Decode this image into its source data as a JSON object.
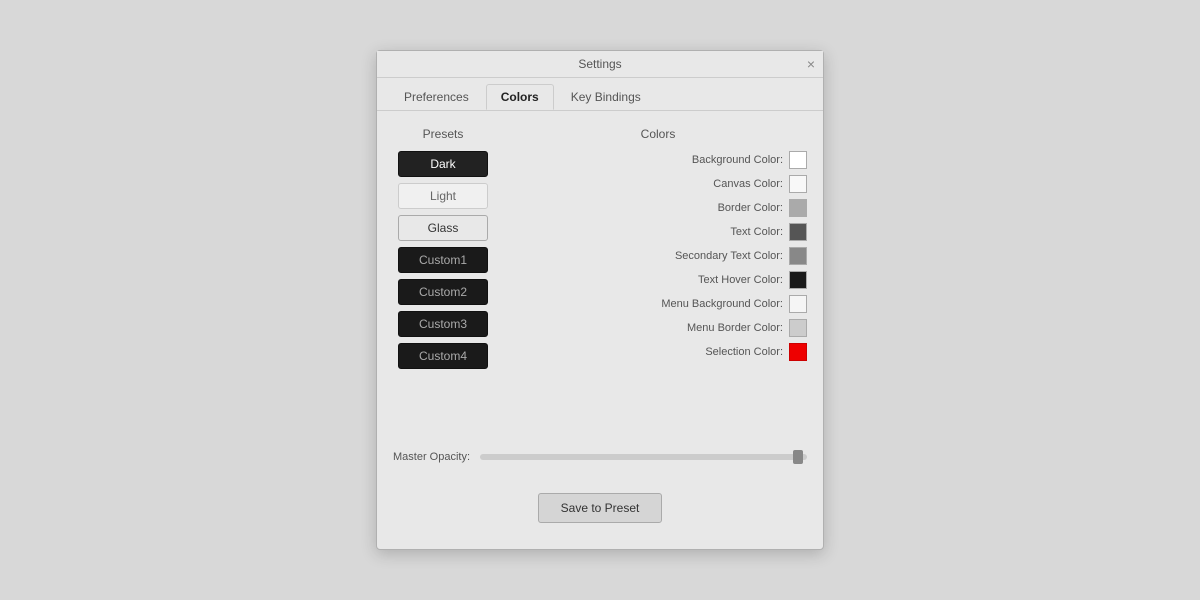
{
  "dialog": {
    "title": "Settings",
    "close_icon": "×"
  },
  "tabs": [
    {
      "id": "preferences",
      "label": "Preferences",
      "active": false
    },
    {
      "id": "colors",
      "label": "Colors",
      "active": true
    },
    {
      "id": "keybindings",
      "label": "Key Bindings",
      "active": false
    }
  ],
  "presets": {
    "title": "Presets",
    "items": [
      {
        "id": "dark",
        "label": "Dark",
        "style": "dark"
      },
      {
        "id": "light",
        "label": "Light",
        "style": "light"
      },
      {
        "id": "glass",
        "label": "Glass",
        "style": "glass"
      },
      {
        "id": "custom1",
        "label": "Custom1",
        "style": "custom1"
      },
      {
        "id": "custom2",
        "label": "Custom2",
        "style": "custom2"
      },
      {
        "id": "custom3",
        "label": "Custom3",
        "style": "custom3"
      },
      {
        "id": "custom4",
        "label": "Custom4",
        "style": "custom4"
      }
    ]
  },
  "colors": {
    "title": "Colors",
    "items": [
      {
        "id": "background-color",
        "label": "Background Color:",
        "swatch": "#ffffff"
      },
      {
        "id": "canvas-color",
        "label": "Canvas Color:",
        "swatch": "#f8f8f8"
      },
      {
        "id": "border-color",
        "label": "Border Color:",
        "swatch": "#aaaaaa"
      },
      {
        "id": "text-color",
        "label": "Text Color:",
        "swatch": "#555555"
      },
      {
        "id": "secondary-text-color",
        "label": "Secondary Text Color:",
        "swatch": "#888888"
      },
      {
        "id": "text-hover-color",
        "label": "Text Hover Color:",
        "swatch": "#1a1a1a"
      },
      {
        "id": "menu-background-color",
        "label": "Menu Background Color:",
        "swatch": "#f5f5f5"
      },
      {
        "id": "menu-border-color",
        "label": "Menu Border Color:",
        "swatch": "#cccccc"
      },
      {
        "id": "selection-color",
        "label": "Selection Color:",
        "swatch": "#ee0000"
      }
    ]
  },
  "opacity": {
    "label": "Master Opacity:"
  },
  "save_button": {
    "label": "Save to Preset"
  }
}
